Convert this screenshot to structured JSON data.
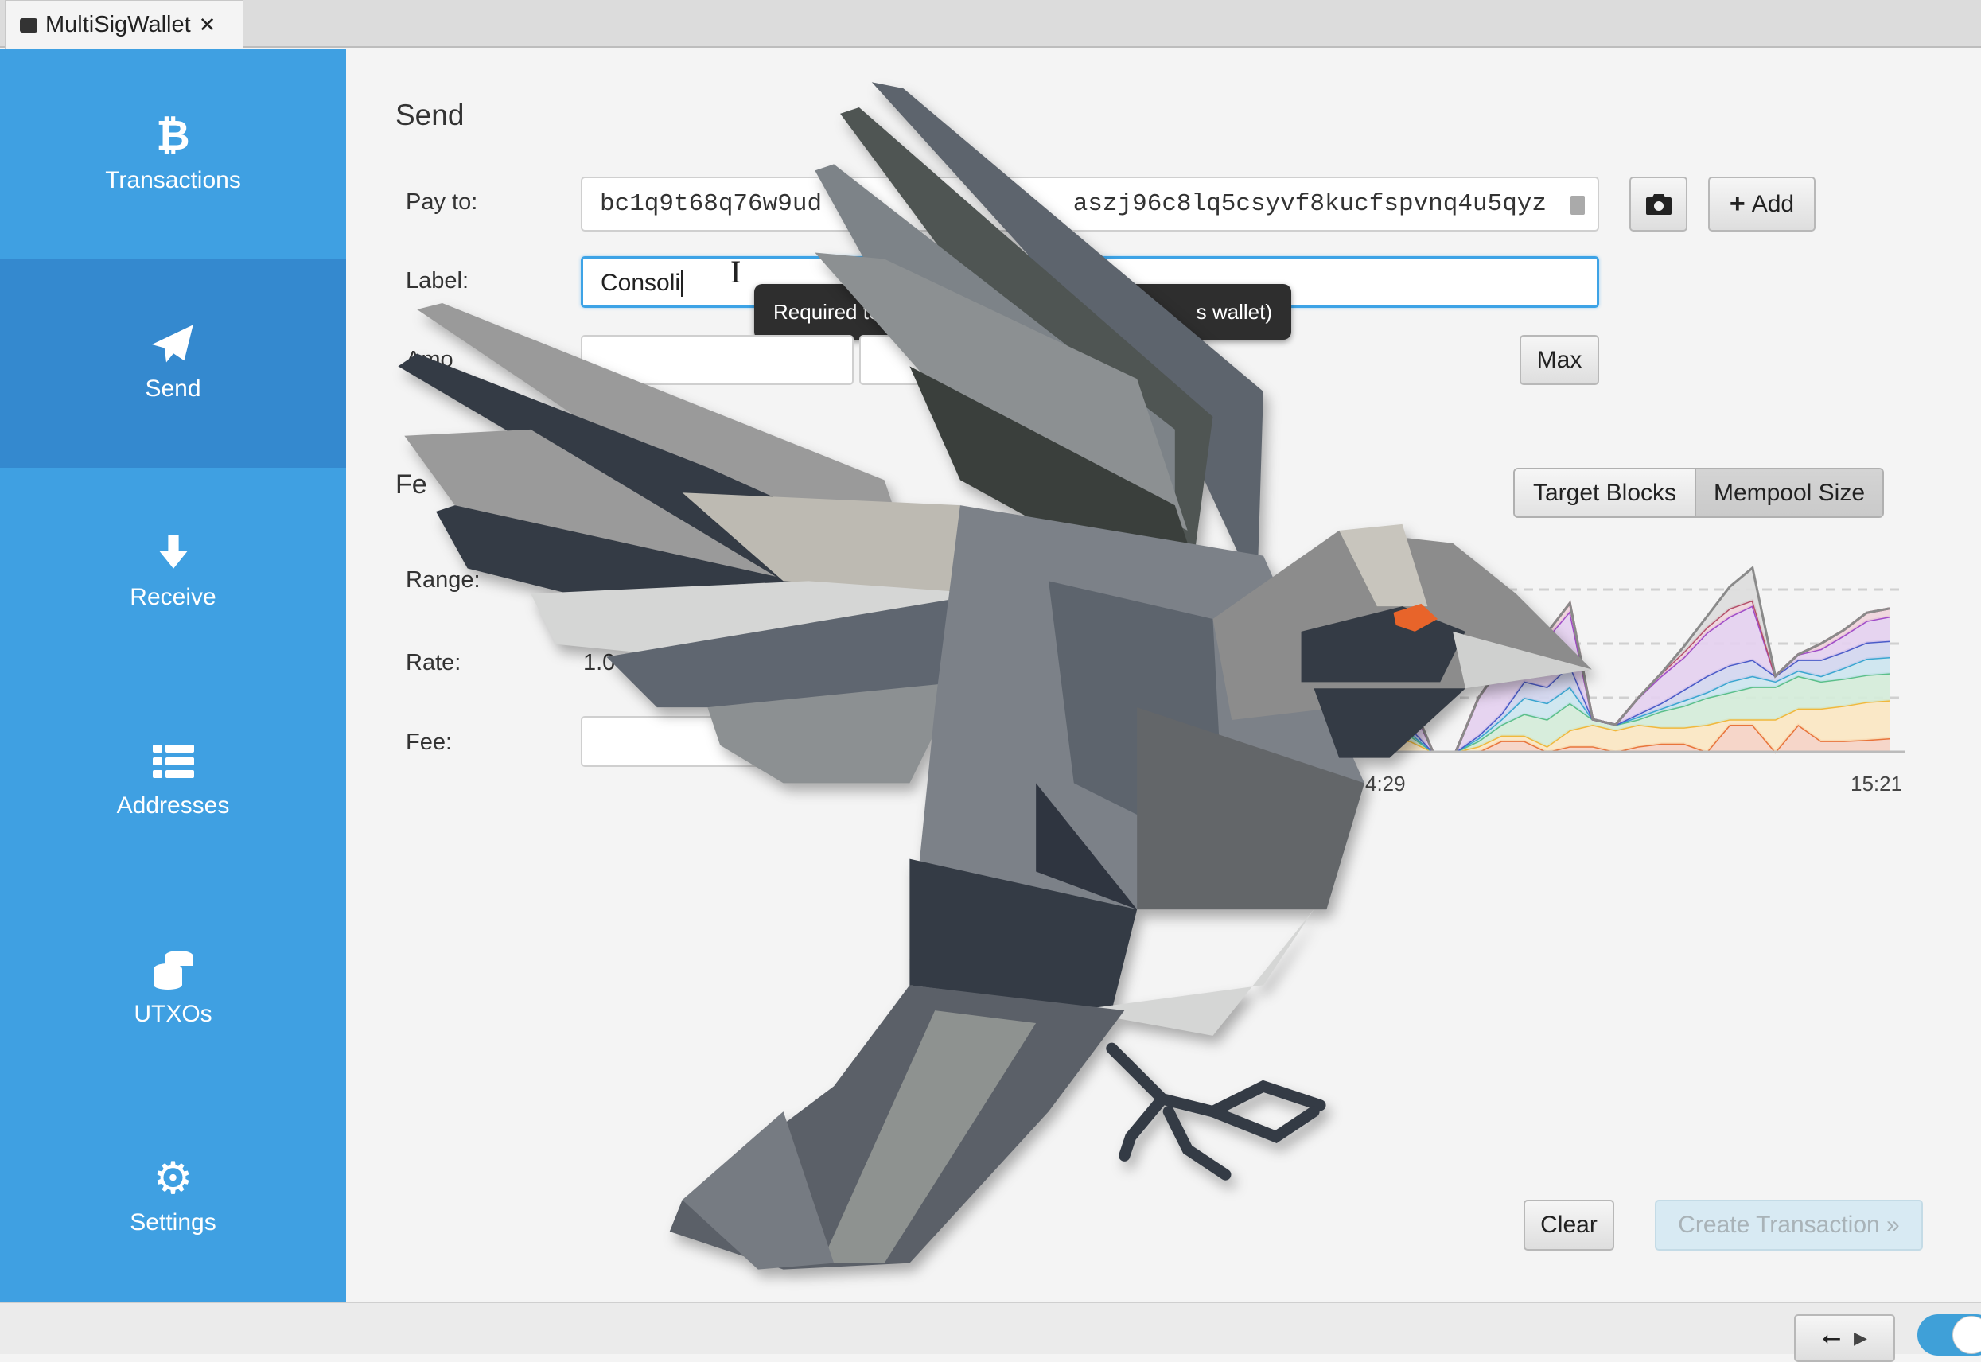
{
  "window": {
    "tab_title": "MultiSigWallet",
    "tab_close": "✕",
    "tab_icon": "wallet-icon"
  },
  "sidebar": {
    "items": [
      {
        "label": "Transactions",
        "icon": "bitcoin-icon",
        "active": false
      },
      {
        "label": "Send",
        "icon": "paper-plane-icon",
        "active": true
      },
      {
        "label": "Receive",
        "icon": "arrow-down-icon",
        "active": false
      },
      {
        "label": "Addresses",
        "icon": "list-icon",
        "active": false
      },
      {
        "label": "UTXOs",
        "icon": "coins-icon",
        "active": false
      },
      {
        "label": "Settings",
        "icon": "gear-icon",
        "active": false
      }
    ]
  },
  "send": {
    "title": "Send",
    "pay_to_label": "Pay to:",
    "pay_to_value_start": "bc1q9t68q76w9ud",
    "pay_to_value_end": "aszj96c8lq5csyvf8kucfspvnq4u5qyz",
    "scan_icon": "camera-icon",
    "add_label": "Add",
    "label_label": "Label:",
    "label_value": "Consoli",
    "tooltip_start": "Required to",
    "tooltip_end": "s wallet)",
    "amount_label": "Amo",
    "amount_value": "",
    "max_label": "Max",
    "fee_heading": "Fe",
    "range_label": "Range:",
    "rate_label": "Rate:",
    "rate_value": "1.0",
    "fee_label": "Fee:",
    "fee_value": "",
    "toggle": {
      "options": [
        "Target Blocks",
        "Mempool Size"
      ],
      "selected": "Mempool Size"
    },
    "clear_label": "Clear",
    "create_label": "Create Transaction »"
  },
  "chart_data": {
    "type": "area",
    "stacked": true,
    "x_tick_labels": [
      "4:29",
      "15:21"
    ],
    "grid": "dashed horizontal",
    "colors": [
      "#e8743b",
      "#f0b83c",
      "#5bbf8a",
      "#3aa6d0",
      "#4a5bc8",
      "#a04cc8",
      "#b5506a",
      "#8a8a8a"
    ],
    "fills": [
      "#f6d3c4",
      "#fbe7c2",
      "#d4ecd9",
      "#cce6f0",
      "#d3d6f0",
      "#e4d0f0",
      "#efd4dc",
      "#dddddd"
    ],
    "series": [
      {
        "values": [
          0,
          0,
          0,
          0,
          0,
          0,
          0.2,
          0.2,
          0,
          0.1,
          0.1,
          0,
          0.1,
          0.15,
          0.15,
          0,
          0.5,
          0.5,
          0,
          0.5,
          0.2,
          0.2,
          0.22,
          0.25
        ]
      },
      {
        "values": [
          0.1,
          0.2,
          0.2,
          0,
          0,
          0.1,
          0.1,
          0.1,
          0.1,
          0.3,
          0.4,
          0.4,
          0.4,
          0.3,
          0.3,
          0.5,
          0.1,
          0.1,
          0.6,
          0.3,
          0.6,
          0.65,
          0.7,
          0.7
        ]
      },
      {
        "values": [
          0.05,
          0.1,
          0.1,
          0,
          0,
          0.1,
          0.2,
          0.4,
          0.5,
          0.5,
          0.1,
          0.1,
          0.1,
          0.3,
          0.4,
          0.5,
          0.5,
          0.6,
          0.6,
          0.6,
          0.5,
          0.5,
          0.5,
          0.5
        ]
      },
      {
        "values": [
          0,
          0.05,
          0.05,
          0,
          0,
          0.05,
          0.1,
          0.3,
          0.3,
          0.3,
          0,
          0,
          0.05,
          0.05,
          0.1,
          0.1,
          0.2,
          0.2,
          0.1,
          0.1,
          0.1,
          0.2,
          0.3,
          0.3
        ]
      },
      {
        "values": [
          0.05,
          0.05,
          0.1,
          0,
          0,
          0.05,
          0.1,
          0.3,
          0.3,
          0.4,
          0,
          0,
          0.05,
          0.1,
          0.2,
          0.3,
          0.3,
          0.3,
          0.1,
          0.2,
          0.3,
          0.3,
          0.3,
          0.3
        ]
      },
      {
        "values": [
          0.2,
          0.3,
          0.5,
          0,
          0,
          0.7,
          0.9,
          0.8,
          0.9,
          1.0,
          0,
          0,
          0.3,
          0.5,
          0.6,
          0.8,
          0.9,
          1.0,
          0,
          0.1,
          0.2,
          0.3,
          0.4,
          0.45
        ]
      },
      {
        "values": [
          0,
          0,
          0.05,
          0,
          0,
          0,
          0,
          0.1,
          0.1,
          0.15,
          0,
          0,
          0,
          0.05,
          0.1,
          0.1,
          0.15,
          0.1,
          0,
          0,
          0.1,
          0.1,
          0.15,
          0.15
        ]
      },
      {
        "values": [
          0,
          0,
          0,
          0,
          0,
          0,
          0,
          0,
          0,
          0,
          0,
          0,
          0,
          0,
          0.1,
          0.2,
          0.4,
          0.6,
          0,
          0,
          0,
          0,
          0,
          0
        ]
      }
    ]
  },
  "statusbar": {
    "usb_icon": "usb-icon",
    "play_icon": "play-icon",
    "toggle_on": true
  },
  "colors": {
    "sidebar": "#3fa0e2",
    "sidebar_active": "#3489cf",
    "focus": "#3da3e6"
  }
}
